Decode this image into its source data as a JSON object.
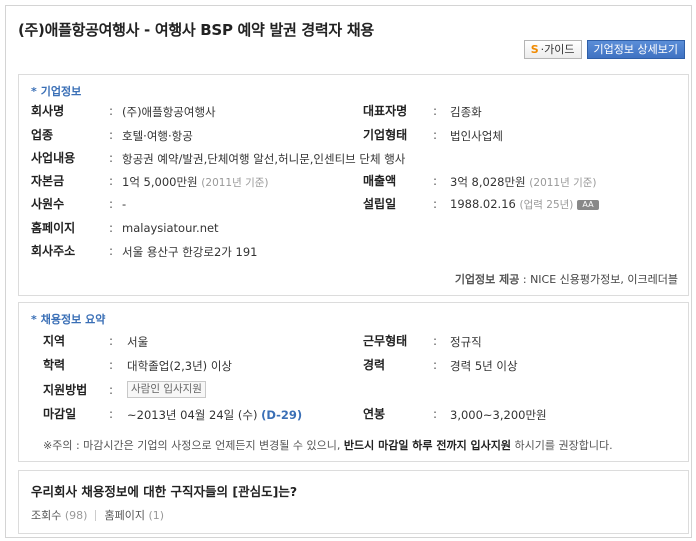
{
  "header": {
    "title": "(주)애플항공여행사 - 여행사 BSP 예약 발권 경력자 채용",
    "guide_icon": "S",
    "guide_label": "·가이드",
    "detail_button": "기업정보 상세보기"
  },
  "company": {
    "section_title": "기업정보",
    "name_label": "회사명",
    "name_value": "(주)애플항공여행사",
    "ceo_label": "대표자명",
    "ceo_value": "김종화",
    "industry_label": "업종",
    "industry_value": "호텔·여행·항공",
    "type_label": "기업형태",
    "type_value": "법인사업체",
    "business_label": "사업내용",
    "business_value": "항공권 예약/발권,단체여행 알선,허니문,인센티브 단체 행사",
    "capital_label": "자본금",
    "capital_value": "1억 5,000만원",
    "capital_note": "(2011년 기준)",
    "sales_label": "매출액",
    "sales_value": "3억 8,028만원",
    "sales_note": "(2011년 기준)",
    "employees_label": "사원수",
    "employees_value": "-",
    "founded_label": "설립일",
    "founded_value": "1988.02.16",
    "founded_note": "(업력 25년)",
    "founded_badge": "AA",
    "homepage_label": "홈페이지",
    "homepage_value": "malaysiatour.net",
    "address_label": "회사주소",
    "address_value": "서울 용산구 한강로2가 191",
    "source_label": "기업정보 제공",
    "source_value": ": NICE 신용평가정보, 이크레더블"
  },
  "recruit": {
    "section_title": "채용정보 요약",
    "region_label": "지역",
    "region_value": "서울",
    "worktype_label": "근무형태",
    "worktype_value": "정규직",
    "education_label": "학력",
    "education_value": "대학졸업(2,3년) 이상",
    "career_label": "경력",
    "career_value": "경력 5년 이상",
    "apply_label": "지원방법",
    "apply_value": "사람인 입사지원",
    "deadline_label": "마감일",
    "deadline_value": "~2013년 04월 24일 (수)",
    "deadline_dday": "(D-29)",
    "salary_label": "연봉",
    "salary_value": "3,000~3,200만원",
    "notice_prefix": "※주의 : 마감시간은 기업의 사정으로 언제든지 변경될 수 있으니, ",
    "notice_bold": "반드시 마감일 하루 전까지 입사지원",
    "notice_suffix": " 하시기를 권장합니다."
  },
  "interest": {
    "question": "우리회사 채용정보에 대한 구직자들의 [관심도]는?",
    "views_label": "조회수",
    "views_value": "(98)",
    "homepage_label": "홈페이지",
    "homepage_value": "(1)"
  }
}
